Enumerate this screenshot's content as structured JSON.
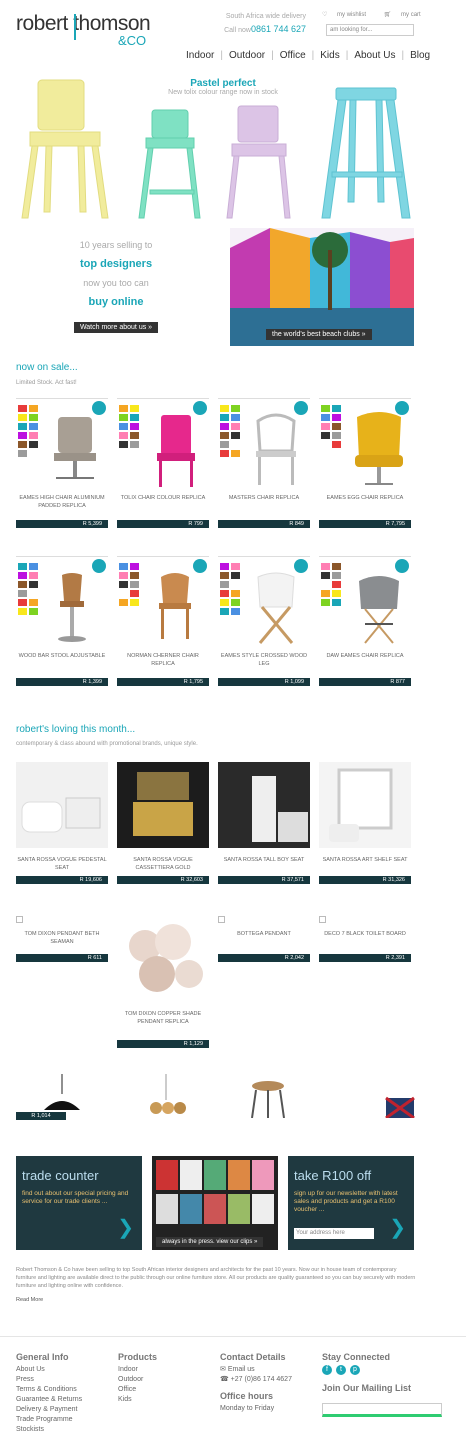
{
  "header": {
    "logo_line1": "robert thomson",
    "logo_line2": "&CO",
    "delivery": "South Africa wide delivery",
    "call_prefix": "Call now",
    "phone": "0861 744 627",
    "wishlist": "my wishlist",
    "cart": "my cart",
    "search_placeholder": "am looking for..."
  },
  "nav": [
    "Indoor",
    "Outdoor",
    "Office",
    "Kids",
    "About Us",
    "Blog"
  ],
  "hero": {
    "title": "Pastel perfect",
    "subtitle": "New tolix colour range now in stock"
  },
  "promo": {
    "line1": "10 years selling to",
    "line2": "top designers",
    "line3": "now you too can",
    "line4": "buy online",
    "cta": "Watch more about us »",
    "caption": "the world's best beach clubs »"
  },
  "sale": {
    "title": "now on sale...",
    "subtitle": "Limited Stock. Act fast!",
    "products": [
      {
        "name": "EAMES HIGH CHAIR ALUMINIUM PADDED REPLICA",
        "price": "R 5,399"
      },
      {
        "name": "TOLIX CHAIR COLOUR REPLICA",
        "price": "R 799"
      },
      {
        "name": "MASTERS CHAIR REPLICA",
        "price": "R 849"
      },
      {
        "name": "EAMES EGG CHAIR REPLICA",
        "price": "R 7,795"
      },
      {
        "name": "WOOD BAR STOOL ADJUSTABLE",
        "price": "R 1,399"
      },
      {
        "name": "NORMAN CHERNER CHAIR REPLICA",
        "price": "R 1,795"
      },
      {
        "name": "EAMES STYLE CROSSED WOOD LEG",
        "price": "R 1,099"
      },
      {
        "name": "DAW EAMES CHAIR REPLICA",
        "price": "R 877"
      }
    ]
  },
  "loving": {
    "title": "robert's loving this month...",
    "subtitle": "contemporary & class abound with promotional brands, unique style.",
    "products": [
      {
        "name": "SANTA ROSSA VOGUE PEDESTAL SEAT",
        "price": "R 19,606"
      },
      {
        "name": "SANTA ROSSA VOGUE CASSETTIERA GOLD",
        "price": "R 32,603"
      },
      {
        "name": "SANTA ROSSA TALL BOY SEAT",
        "price": "R 37,571"
      },
      {
        "name": "SANTA ROSSA ART SHELF SEAT",
        "price": "R 31,326"
      }
    ],
    "row2": [
      {
        "name": "TOM DIXON PENDANT BETH SEAMAN",
        "price": "R 611"
      },
      {
        "name": "TOM DIXON COPPER SHADE PENDANT REPLICA",
        "price": "R 1,129"
      },
      {
        "name": "BOTTEGA PENDANT",
        "price": "R 2,042"
      },
      {
        "name": "DECO 7 BLACK TOILET BOARD",
        "price": "R 2,391"
      }
    ],
    "row3_price": "R 1,014"
  },
  "trade": {
    "title": "trade counter",
    "text": "find out about our special pricing and service for our trade clients ..."
  },
  "press": {
    "caption": "always in the press. view our clips »"
  },
  "newsletter": {
    "title": "take R100 off",
    "text": "sign up for our newsletter with latest sales and products and get a R100 voucher ...",
    "placeholder": "Your address here"
  },
  "about": {
    "text": "Robert Thomson & Co have been selling to top South African interior designers and architects for the past 10 years. Now our in house team of contemporary furniture and lighting are available direct to the public through our online furniture store. All our products are quality guaranteed so you can buy securely with modern furniture and lighting online with confidence.",
    "more": "Read More"
  },
  "footer": {
    "general": {
      "title": "General Info",
      "items": [
        "About Us",
        "Press",
        "Terms & Conditions",
        "Guarantee & Returns",
        "Delivery & Payment",
        "Trade Programme",
        "Stockists"
      ]
    },
    "products": {
      "title": "Products",
      "items": [
        "Indoor",
        "Outdoor",
        "Office",
        "Kids"
      ]
    },
    "contact": {
      "title": "Contact Details",
      "email": "Email us",
      "phone": "+27 (0)86 174 4627",
      "hours_title": "Office hours",
      "hours": "Monday to Friday"
    },
    "social": {
      "title": "Stay Connected",
      "mailing": "Join Our Mailing List"
    }
  },
  "colors": {
    "accent": "#1aa6b7",
    "dark": "#16373e"
  }
}
